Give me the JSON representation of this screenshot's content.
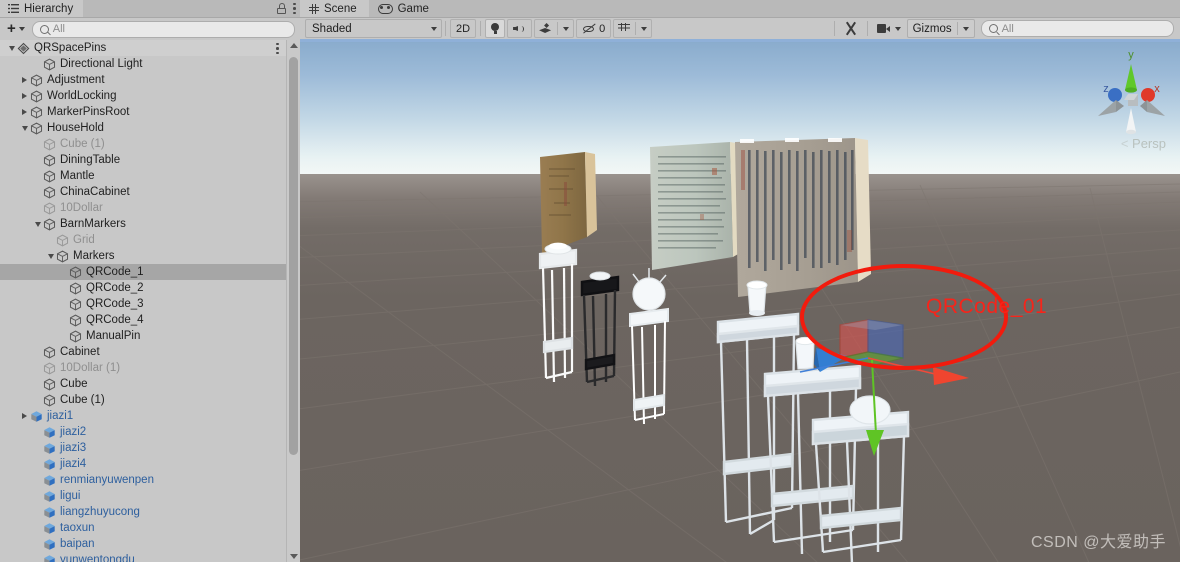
{
  "hierarchy_panel": {
    "tab": {
      "label": "Hierarchy",
      "icon": "hierarchy-list-icon"
    },
    "lock_icon": "lock-icon",
    "menu_icon": "kebab-menu-icon",
    "toolbar": {
      "add_label": "+",
      "add_dropdown_icon": "chevron-down-icon",
      "search_icon": "search-icon",
      "search_placeholder": "All",
      "search_value": ""
    },
    "tree": [
      {
        "label": "QRSpacePins",
        "depth": 0,
        "icon": "unity-scene-icon",
        "expanded": true,
        "state": "root",
        "menu": true
      },
      {
        "label": "Directional Light",
        "depth": 2,
        "icon": "gameobject-icon",
        "expanded": null,
        "state": "normal"
      },
      {
        "label": "Adjustment",
        "depth": 1,
        "icon": "gameobject-icon",
        "expanded": false,
        "state": "normal"
      },
      {
        "label": "WorldLocking",
        "depth": 1,
        "icon": "gameobject-icon",
        "expanded": false,
        "state": "normal"
      },
      {
        "label": "MarkerPinsRoot",
        "depth": 1,
        "icon": "gameobject-icon",
        "expanded": false,
        "state": "normal"
      },
      {
        "label": "HouseHold",
        "depth": 1,
        "icon": "gameobject-icon",
        "expanded": true,
        "state": "normal"
      },
      {
        "label": "Cube (1)",
        "depth": 2,
        "icon": "gameobject-icon",
        "expanded": null,
        "state": "disabled"
      },
      {
        "label": "DiningTable",
        "depth": 2,
        "icon": "gameobject-icon",
        "expanded": null,
        "state": "normal"
      },
      {
        "label": "Mantle",
        "depth": 2,
        "icon": "gameobject-icon",
        "expanded": null,
        "state": "normal"
      },
      {
        "label": "ChinaCabinet",
        "depth": 2,
        "icon": "gameobject-icon",
        "expanded": null,
        "state": "normal"
      },
      {
        "label": "10Dollar",
        "depth": 2,
        "icon": "gameobject-icon",
        "expanded": null,
        "state": "disabled"
      },
      {
        "label": "BarnMarkers",
        "depth": 2,
        "icon": "gameobject-icon",
        "expanded": true,
        "state": "normal"
      },
      {
        "label": "Grid",
        "depth": 3,
        "icon": "gameobject-icon",
        "expanded": null,
        "state": "disabled"
      },
      {
        "label": "Markers",
        "depth": 3,
        "icon": "gameobject-icon",
        "expanded": true,
        "state": "normal"
      },
      {
        "label": "QRCode_1",
        "depth": 4,
        "icon": "gameobject-icon",
        "expanded": null,
        "state": "selected"
      },
      {
        "label": "QRCode_2",
        "depth": 4,
        "icon": "gameobject-icon",
        "expanded": null,
        "state": "normal"
      },
      {
        "label": "QRCode_3",
        "depth": 4,
        "icon": "gameobject-icon",
        "expanded": null,
        "state": "normal"
      },
      {
        "label": "QRCode_4",
        "depth": 4,
        "icon": "gameobject-icon",
        "expanded": null,
        "state": "normal"
      },
      {
        "label": "ManualPin",
        "depth": 4,
        "icon": "gameobject-icon",
        "expanded": null,
        "state": "normal"
      },
      {
        "label": "Cabinet",
        "depth": 2,
        "icon": "gameobject-icon",
        "expanded": null,
        "state": "normal"
      },
      {
        "label": "10Dollar (1)",
        "depth": 2,
        "icon": "gameobject-icon",
        "expanded": null,
        "state": "disabled"
      },
      {
        "label": "Cube",
        "depth": 2,
        "icon": "gameobject-icon",
        "expanded": null,
        "state": "normal"
      },
      {
        "label": "Cube (1)",
        "depth": 2,
        "icon": "gameobject-icon",
        "expanded": null,
        "state": "normal"
      },
      {
        "label": "jiazi1",
        "depth": 1,
        "icon": "prefab-icon",
        "expanded": false,
        "state": "prefab"
      },
      {
        "label": "jiazi2",
        "depth": 2,
        "icon": "prefab-icon",
        "expanded": null,
        "state": "prefab"
      },
      {
        "label": "jiazi3",
        "depth": 2,
        "icon": "prefab-icon",
        "expanded": null,
        "state": "prefab"
      },
      {
        "label": "jiazi4",
        "depth": 2,
        "icon": "prefab-icon",
        "expanded": null,
        "state": "prefab"
      },
      {
        "label": "renmianyuwenpen",
        "depth": 2,
        "icon": "prefab-icon",
        "expanded": null,
        "state": "prefab"
      },
      {
        "label": "ligui",
        "depth": 2,
        "icon": "prefab-icon",
        "expanded": null,
        "state": "prefab"
      },
      {
        "label": "liangzhuyucong",
        "depth": 2,
        "icon": "prefab-icon",
        "expanded": null,
        "state": "prefab"
      },
      {
        "label": "taoxun",
        "depth": 2,
        "icon": "prefab-icon",
        "expanded": null,
        "state": "prefab"
      },
      {
        "label": "baipan",
        "depth": 2,
        "icon": "prefab-icon",
        "expanded": null,
        "state": "prefab"
      },
      {
        "label": "yunwentongdu",
        "depth": 2,
        "icon": "prefab-icon",
        "expanded": null,
        "state": "prefab"
      }
    ],
    "scrollbar": {
      "up_icon": "scroll-up-arrow-icon",
      "down_icon": "scroll-down-arrow-icon"
    }
  },
  "scene_panel": {
    "tabs": [
      {
        "label": "Scene",
        "icon": "scene-grid-icon",
        "active": true
      },
      {
        "label": "Game",
        "icon": "game-controller-icon",
        "active": false
      }
    ],
    "toolbar": {
      "draw_mode": "Shaded",
      "draw_mode_arrow": "chevron-down-icon",
      "toggle_2d": "2D",
      "lighting_icon": "lightbulb-icon",
      "audio_icon": "speaker-icon",
      "fx_icon": "effects-icon",
      "fx_arrow": "chevron-down-icon",
      "hidden_objects_icon": "eye-off-icon",
      "hidden_objects_count": "0",
      "grid_icon": "grid-visibility-icon",
      "grid_arrow": "chevron-down-icon",
      "tools_icon": "scene-tools-icon",
      "camera_icon": "scene-camera-icon",
      "camera_arrow": "chevron-down-icon",
      "gizmos_label": "Gizmos",
      "gizmos_arrow": "chevron-down-icon",
      "search_icon": "search-icon",
      "search_placeholder": "All",
      "search_value": ""
    },
    "viewport": {
      "compass": {
        "axis_y_label": "y",
        "axis_x_label": "x",
        "axis_z_label": "z",
        "x_color": "#e03a2a",
        "y_color": "#5fc425",
        "z_color": "#2f6fd0",
        "projection_label": "Persp",
        "projection_arrow_icon": "chevron-left-icon"
      },
      "colors": {
        "sky_top": "#8aaccd",
        "sky_horizon": "#f4f8f6",
        "ground": "#6a635e",
        "grid_line": "#847c77"
      },
      "selection_gizmo": {
        "axis_x_color": "#f04a3a",
        "axis_y_color": "#5fc425",
        "axis_z_color": "#3f7fd8",
        "handle": "move-tool-gizmo"
      },
      "annotation": {
        "ellipse_color": "#f21b0d",
        "label": "QRCode_01",
        "label_color": "#f7241a"
      },
      "watermark": "CSDN @大爱助手"
    }
  }
}
